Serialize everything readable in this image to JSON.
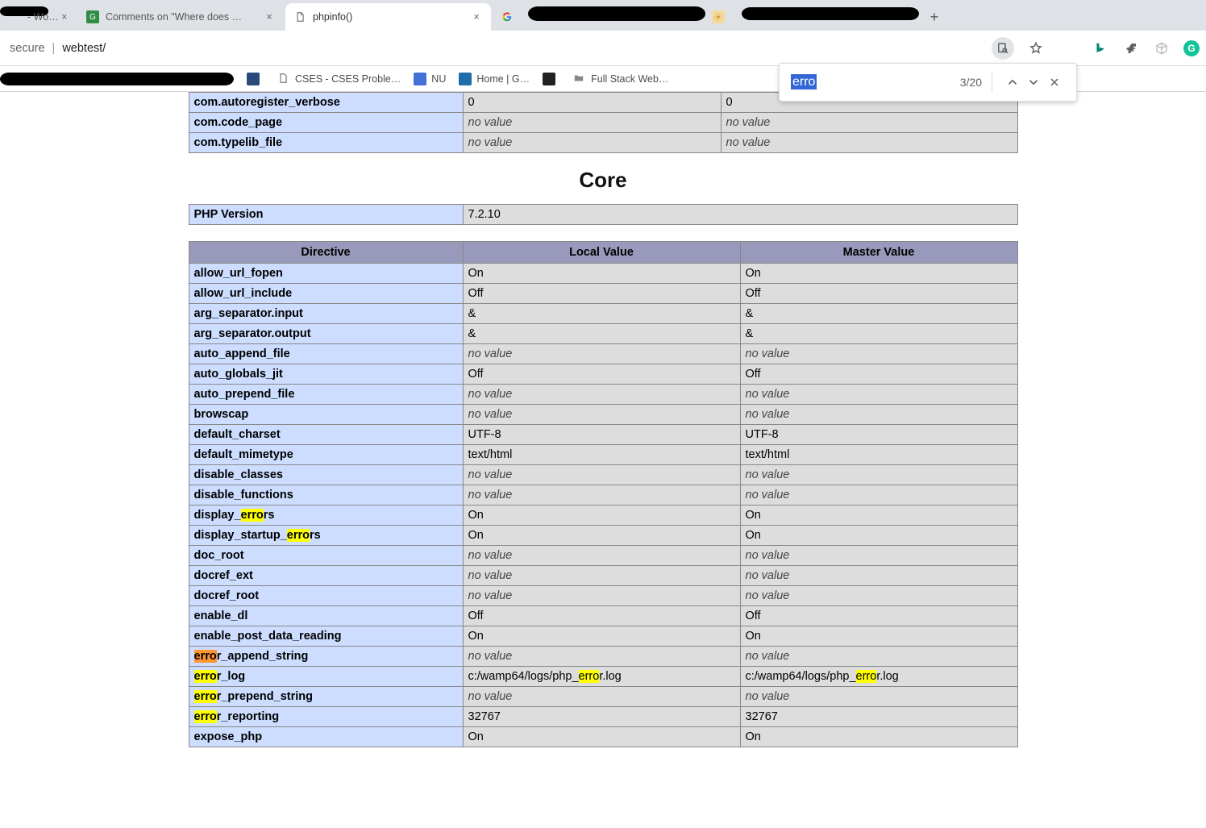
{
  "tabs": [
    {
      "title": "- WordPr…",
      "favicon": "",
      "active": false,
      "closeable": true
    },
    {
      "title": "Comments on \"Where does PHP",
      "favicon": "gfg",
      "active": false,
      "closeable": true
    },
    {
      "title": "phpinfo()",
      "favicon": "page",
      "active": true,
      "closeable": true
    },
    {
      "title": "",
      "favicon": "g",
      "active": false,
      "closeable": true,
      "redacted": true
    },
    {
      "title": "",
      "favicon": "sun",
      "active": false,
      "closeable": true,
      "redacted": true
    }
  ],
  "address": {
    "secure": "secure",
    "path": "webtest/"
  },
  "bookmarks": [
    {
      "label": "",
      "icon": "#2b4a7c"
    },
    {
      "label": "CSES - CSES Proble…",
      "icon": "page"
    },
    {
      "label": "NU",
      "icon": "#4570d6"
    },
    {
      "label": "Home | G…",
      "icon": "#1e6ca8"
    },
    {
      "label": "",
      "icon": "#222"
    },
    {
      "label": "Full Stack Web…",
      "icon": "folder"
    }
  ],
  "find": {
    "query": "erro",
    "count": "3/20"
  },
  "section_title": "Core",
  "php_version_label": "PHP Version",
  "php_version_value": "7.2.10",
  "top_table": [
    {
      "dir": "com.autoregister_verbose",
      "lv": "0",
      "mv": "0",
      "novL": false,
      "novM": false
    },
    {
      "dir": "com.code_page",
      "lv": "no value",
      "mv": "no value",
      "novL": true,
      "novM": true
    },
    {
      "dir": "com.typelib_file",
      "lv": "no value",
      "mv": "no value",
      "novL": true,
      "novM": true
    }
  ],
  "headers": {
    "dir": "Directive",
    "lv": "Local Value",
    "mv": "Master Value"
  },
  "core": [
    {
      "dir": "allow_url_fopen",
      "lv": "On",
      "mv": "On"
    },
    {
      "dir": "allow_url_include",
      "lv": "Off",
      "mv": "Off"
    },
    {
      "dir": "arg_separator.input",
      "lv": "&",
      "mv": "&"
    },
    {
      "dir": "arg_separator.output",
      "lv": "&",
      "mv": "&"
    },
    {
      "dir": "auto_append_file",
      "lv": "no value",
      "mv": "no value",
      "novL": true,
      "novM": true
    },
    {
      "dir": "auto_globals_jit",
      "lv": "Off",
      "mv": "Off"
    },
    {
      "dir": "auto_prepend_file",
      "lv": "no value",
      "mv": "no value",
      "novL": true,
      "novM": true
    },
    {
      "dir": "browscap",
      "lv": "no value",
      "mv": "no value",
      "novL": true,
      "novM": true
    },
    {
      "dir": "default_charset",
      "lv": "UTF-8",
      "mv": "UTF-8"
    },
    {
      "dir": "default_mimetype",
      "lv": "text/html",
      "mv": "text/html"
    },
    {
      "dir": "disable_classes",
      "lv": "no value",
      "mv": "no value",
      "novL": true,
      "novM": true
    },
    {
      "dir": "disable_functions",
      "lv": "no value",
      "mv": "no value",
      "novL": true,
      "novM": true
    },
    {
      "dir": "display_errors",
      "lv": "On",
      "mv": "On",
      "hilite": [
        8,
        12
      ]
    },
    {
      "dir": "display_startup_errors",
      "lv": "On",
      "mv": "On",
      "hilite": [
        16,
        20
      ]
    },
    {
      "dir": "doc_root",
      "lv": "no value",
      "mv": "no value",
      "novL": true,
      "novM": true
    },
    {
      "dir": "docref_ext",
      "lv": "no value",
      "mv": "no value",
      "novL": true,
      "novM": true
    },
    {
      "dir": "docref_root",
      "lv": "no value",
      "mv": "no value",
      "novL": true,
      "novM": true
    },
    {
      "dir": "enable_dl",
      "lv": "Off",
      "mv": "Off"
    },
    {
      "dir": "enable_post_data_reading",
      "lv": "On",
      "mv": "On"
    },
    {
      "dir": "error_append_string",
      "lv": "no value",
      "mv": "no value",
      "novL": true,
      "novM": true,
      "hilite": [
        0,
        4
      ],
      "current": true
    },
    {
      "dir": "error_log",
      "lv": "c:/wamp64/logs/php_error.log",
      "mv": "c:/wamp64/logs/php_error.log",
      "hilite": [
        0,
        4
      ],
      "lvHilite": [
        19,
        23
      ],
      "mvHilite": [
        19,
        23
      ]
    },
    {
      "dir": "error_prepend_string",
      "lv": "no value",
      "mv": "no value",
      "novL": true,
      "novM": true,
      "hilite": [
        0,
        4
      ]
    },
    {
      "dir": "error_reporting",
      "lv": "32767",
      "mv": "32767",
      "hilite": [
        0,
        4
      ]
    },
    {
      "dir": "expose_php",
      "lv": "On",
      "mv": "On"
    }
  ]
}
